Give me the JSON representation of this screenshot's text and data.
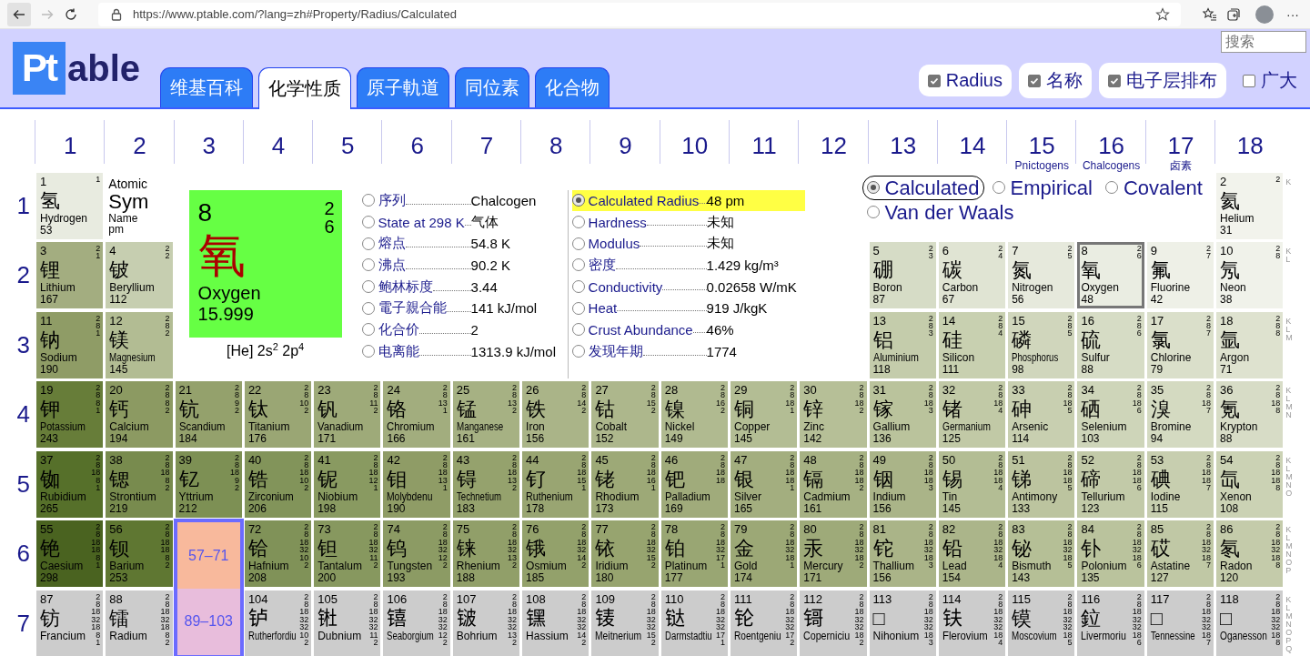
{
  "browser": {
    "url": "https://www.ptable.com/?lang=zh#Property/Radius/Calculated",
    "more": "···"
  },
  "header": {
    "logo": {
      "mark": "Pt",
      "text": "able"
    },
    "tabs": [
      {
        "label": "维基百科",
        "selected": false
      },
      {
        "label": "化学性质",
        "selected": true
      },
      {
        "label": "原子軌道",
        "selected": false
      },
      {
        "label": "同位素",
        "selected": false
      },
      {
        "label": "化合物",
        "selected": false
      }
    ],
    "search": {
      "placeholder": "搜索"
    },
    "options": [
      {
        "label": "Radius",
        "checked": true
      },
      {
        "label": "名称",
        "checked": true
      },
      {
        "label": "电子层排布",
        "checked": true
      },
      {
        "label": "广大",
        "checked": false
      }
    ]
  },
  "groups": [
    {
      "number": "1"
    },
    {
      "number": "2"
    },
    {
      "number": "3"
    },
    {
      "number": "4"
    },
    {
      "number": "5"
    },
    {
      "number": "6"
    },
    {
      "number": "7"
    },
    {
      "number": "8"
    },
    {
      "number": "9"
    },
    {
      "number": "10"
    },
    {
      "number": "11"
    },
    {
      "number": "12"
    },
    {
      "number": "13"
    },
    {
      "number": "14"
    },
    {
      "number": "15",
      "name": "Pnictogens"
    },
    {
      "number": "16",
      "name": "Chalcogens"
    },
    {
      "number": "17",
      "name": "卤素"
    },
    {
      "number": "18"
    }
  ],
  "detail": {
    "number": "8",
    "shells": [
      "2",
      "6"
    ],
    "symbol": "氧",
    "name": "Oxygen",
    "mass": "15.999",
    "configuration": "[He] 2s$^{2}$ 2p$^{4}$",
    "property_columns": [
      {
        "rows": [
          {
            "label": "序列",
            "value": "Chalcogen",
            "selected": false
          },
          {
            "label": "State at 298 K",
            "value": "气体",
            "selected": false
          },
          {
            "label": "熔点",
            "value": "54.8 K",
            "selected": false
          },
          {
            "label": "沸点",
            "value": "90.2 K",
            "selected": false
          },
          {
            "label": "鲍林标度",
            "value": "3.44",
            "selected": false
          },
          {
            "label": "電子親合能",
            "value": "141 kJ/mol",
            "selected": false
          },
          {
            "label": "化合价",
            "value": "2",
            "selected": false
          },
          {
            "label": "电离能",
            "value": "1313.9 kJ/mol",
            "selected": false
          }
        ]
      },
      {
        "rows": [
          {
            "label": "Calculated Radius",
            "value": "48 pm",
            "selected": true
          },
          {
            "label": "Hardness",
            "value": "未知",
            "selected": false
          },
          {
            "label": "Modulus",
            "value": "未知",
            "selected": false
          },
          {
            "label": "密度",
            "value": "1.429 kg/m³",
            "selected": false
          },
          {
            "label": "Conductivity",
            "value": "0.02658 W/mK",
            "selected": false
          },
          {
            "label": "Heat",
            "value": "919 J/kgK",
            "selected": false
          },
          {
            "label": "Crust Abundance",
            "value": "46%",
            "selected": false
          },
          {
            "label": "发现年期",
            "value": "1774",
            "selected": false
          }
        ]
      }
    ]
  },
  "radius_types": [
    {
      "label": "Calculated",
      "selected": true
    },
    {
      "label": "Empirical",
      "selected": false
    },
    {
      "label": "Covalent",
      "selected": false
    },
    {
      "label": "Van der Waals",
      "selected": false
    }
  ],
  "periods": [
    {
      "number": "1",
      "shell_letters": [
        "K"
      ],
      "cells": [
        {
          "kind": "element",
          "number": "1",
          "symbol": "氢",
          "name": "Hydrogen",
          "value": "53",
          "shells": [
            "1"
          ],
          "color": "#e8ebe0",
          "selected": false
        },
        {
          "kind": "legend",
          "number": "Atomic",
          "symbol": "Sym",
          "name": "Name",
          "value": "pm"
        },
        {
          "kind": "element",
          "number": "2",
          "symbol": "氦",
          "name": "Helium",
          "value": "31",
          "shells": [
            "2"
          ],
          "color": "#f2f3ec",
          "selected": false
        }
      ]
    },
    {
      "number": "2",
      "shell_letters": [
        "K",
        "L"
      ],
      "cells": [
        {
          "kind": "element",
          "number": "3",
          "symbol": "锂",
          "name": "Lithium",
          "value": "167",
          "shells": [
            "2",
            "1"
          ],
          "color": "#a3ad80",
          "selected": false
        },
        {
          "kind": "element",
          "number": "4",
          "symbol": "铍",
          "name": "Beryllium",
          "value": "112",
          "shells": [
            "2",
            "2"
          ],
          "color": "#c6ceb0",
          "selected": false
        },
        {
          "kind": "element",
          "number": "5",
          "symbol": "硼",
          "name": "Boron",
          "value": "87",
          "shells": [
            "2",
            "3"
          ],
          "color": "#d6dcc6",
          "selected": false
        },
        {
          "kind": "element",
          "number": "6",
          "symbol": "碳",
          "name": "Carbon",
          "value": "67",
          "shells": [
            "2",
            "4"
          ],
          "color": "#e0e4d3",
          "selected": false
        },
        {
          "kind": "element",
          "number": "7",
          "symbol": "氮",
          "name": "Nitrogen",
          "value": "56",
          "shells": [
            "2",
            "5"
          ],
          "color": "#e6e9dc",
          "selected": false
        },
        {
          "kind": "element",
          "number": "8",
          "symbol": "氧",
          "name": "Oxygen",
          "value": "48",
          "shells": [
            "2",
            "6"
          ],
          "color": "#eaede2",
          "selected": true
        },
        {
          "kind": "element",
          "number": "9",
          "symbol": "氟",
          "name": "Fluorine",
          "value": "42",
          "shells": [
            "2",
            "7"
          ],
          "color": "#eef0e7",
          "selected": false
        },
        {
          "kind": "element",
          "number": "10",
          "symbol": "氖",
          "name": "Neon",
          "value": "38",
          "shells": [
            "2",
            "8"
          ],
          "color": "#f0f2ea",
          "selected": false
        }
      ]
    },
    {
      "number": "3",
      "shell_letters": [
        "K",
        "L",
        "M"
      ],
      "cells": [
        {
          "kind": "element",
          "number": "11",
          "symbol": "钠",
          "name": "Sodium",
          "value": "190",
          "shells": [
            "2",
            "8",
            "1"
          ],
          "color": "#8f9c66",
          "selected": false
        },
        {
          "kind": "element",
          "number": "12",
          "symbol": "镁",
          "name": "Magnesium",
          "value": "145",
          "shells": [
            "2",
            "8",
            "2"
          ],
          "color": "#b2bc93",
          "selected": false
        },
        {
          "kind": "element",
          "number": "13",
          "symbol": "铝",
          "name": "Aluminium",
          "value": "118",
          "shells": [
            "2",
            "8",
            "3"
          ],
          "color": "#c4ccab",
          "selected": false
        },
        {
          "kind": "element",
          "number": "14",
          "symbol": "硅",
          "name": "Silicon",
          "value": "111",
          "shells": [
            "2",
            "8",
            "4"
          ],
          "color": "#c8d0b0",
          "selected": false
        },
        {
          "kind": "element",
          "number": "15",
          "symbol": "磷",
          "name": "Phosphorus",
          "value": "98",
          "shells": [
            "2",
            "8",
            "5"
          ],
          "color": "#d0d6bc",
          "selected": false
        },
        {
          "kind": "element",
          "number": "16",
          "symbol": "硫",
          "name": "Sulfur",
          "value": "88",
          "shells": [
            "2",
            "8",
            "6"
          ],
          "color": "#d6dcc5",
          "selected": false
        },
        {
          "kind": "element",
          "number": "17",
          "symbol": "氯",
          "name": "Chlorine",
          "value": "79",
          "shells": [
            "2",
            "8",
            "7"
          ],
          "color": "#dadfca",
          "selected": false
        },
        {
          "kind": "element",
          "number": "18",
          "symbol": "氩",
          "name": "Argon",
          "value": "71",
          "shells": [
            "2",
            "8",
            "8"
          ],
          "color": "#dee2cf",
          "selected": false
        }
      ]
    },
    {
      "number": "4",
      "shell_letters": [
        "K",
        "L",
        "M",
        "N"
      ],
      "cells": [
        {
          "kind": "element",
          "number": "19",
          "symbol": "钾",
          "name": "Potassium",
          "value": "243",
          "shells": [
            "2",
            "8",
            "8",
            "1"
          ],
          "color": "#677d39",
          "selected": false
        },
        {
          "kind": "element",
          "number": "20",
          "symbol": "钙",
          "name": "Calcium",
          "value": "194",
          "shells": [
            "2",
            "8",
            "8",
            "2"
          ],
          "color": "#8c9a62",
          "selected": false
        },
        {
          "kind": "element",
          "number": "21",
          "symbol": "钪",
          "name": "Scandium",
          "value": "184",
          "shells": [
            "2",
            "8",
            "9",
            "2"
          ],
          "color": "#94a16c",
          "selected": false
        },
        {
          "kind": "element",
          "number": "22",
          "symbol": "钛",
          "name": "Titanium",
          "value": "176",
          "shells": [
            "2",
            "8",
            "10",
            "2"
          ],
          "color": "#9aa674",
          "selected": false
        },
        {
          "kind": "element",
          "number": "23",
          "symbol": "钒",
          "name": "Vanadium",
          "value": "171",
          "shells": [
            "2",
            "8",
            "11",
            "2"
          ],
          "color": "#9eaa79",
          "selected": false
        },
        {
          "kind": "element",
          "number": "24",
          "symbol": "铬",
          "name": "Chromium",
          "value": "166",
          "shells": [
            "2",
            "8",
            "13",
            "1"
          ],
          "color": "#a2ad7e",
          "selected": false
        },
        {
          "kind": "element",
          "number": "25",
          "symbol": "锰",
          "name": "Manganese",
          "value": "161",
          "shells": [
            "2",
            "8",
            "13",
            "2"
          ],
          "color": "#a6b183",
          "selected": false
        },
        {
          "kind": "element",
          "number": "26",
          "symbol": "铁",
          "name": "Iron",
          "value": "156",
          "shells": [
            "2",
            "8",
            "14",
            "2"
          ],
          "color": "#aab488",
          "selected": false
        },
        {
          "kind": "element",
          "number": "27",
          "symbol": "钴",
          "name": "Cobalt",
          "value": "152",
          "shells": [
            "2",
            "8",
            "15",
            "2"
          ],
          "color": "#adb78c",
          "selected": false
        },
        {
          "kind": "element",
          "number": "28",
          "symbol": "镍",
          "name": "Nickel",
          "value": "149",
          "shells": [
            "2",
            "8",
            "16",
            "2"
          ],
          "color": "#b0ba90",
          "selected": false
        },
        {
          "kind": "element",
          "number": "29",
          "symbol": "铜",
          "name": "Copper",
          "value": "145",
          "shells": [
            "2",
            "8",
            "18",
            "1"
          ],
          "color": "#b3bd94",
          "selected": false
        },
        {
          "kind": "element",
          "number": "30",
          "symbol": "锌",
          "name": "Zinc",
          "value": "142",
          "shells": [
            "2",
            "8",
            "18",
            "2"
          ],
          "color": "#b6bf97",
          "selected": false
        },
        {
          "kind": "element",
          "number": "31",
          "symbol": "镓",
          "name": "Gallium",
          "value": "136",
          "shells": [
            "2",
            "8",
            "18",
            "3"
          ],
          "color": "#bac39c",
          "selected": false
        },
        {
          "kind": "element",
          "number": "32",
          "symbol": "锗",
          "name": "Germanium",
          "value": "125",
          "shells": [
            "2",
            "8",
            "18",
            "4"
          ],
          "color": "#c1c9a6",
          "selected": false
        },
        {
          "kind": "element",
          "number": "33",
          "symbol": "砷",
          "name": "Arsenic",
          "value": "114",
          "shells": [
            "2",
            "8",
            "18",
            "5"
          ],
          "color": "#c8cfb0",
          "selected": false
        },
        {
          "kind": "element",
          "number": "34",
          "symbol": "硒",
          "name": "Selenium",
          "value": "103",
          "shells": [
            "2",
            "8",
            "18",
            "6"
          ],
          "color": "#ced5b9",
          "selected": false
        },
        {
          "kind": "element",
          "number": "35",
          "symbol": "溴",
          "name": "Bromine",
          "value": "94",
          "shells": [
            "2",
            "8",
            "18",
            "7"
          ],
          "color": "#d4dac1",
          "selected": false
        },
        {
          "kind": "element",
          "number": "36",
          "symbol": "氪",
          "name": "Krypton",
          "value": "88",
          "shells": [
            "2",
            "8",
            "18",
            "8"
          ],
          "color": "#d7dcc6",
          "selected": false
        }
      ]
    },
    {
      "number": "5",
      "shell_letters": [
        "K",
        "L",
        "M",
        "N",
        "O"
      ],
      "cells": [
        {
          "kind": "element",
          "number": "37",
          "symbol": "铷",
          "name": "Rubidium",
          "value": "265",
          "shells": [
            "2",
            "8",
            "18",
            "8",
            "1"
          ],
          "color": "#56702a",
          "selected": false
        },
        {
          "kind": "element",
          "number": "38",
          "symbol": "锶",
          "name": "Strontium",
          "value": "219",
          "shells": [
            "2",
            "8",
            "18",
            "8",
            "2"
          ],
          "color": "#788b4e",
          "selected": false
        },
        {
          "kind": "element",
          "number": "39",
          "symbol": "钇",
          "name": "Yttrium",
          "value": "212",
          "shells": [
            "2",
            "8",
            "18",
            "9",
            "2"
          ],
          "color": "#7d9054",
          "selected": false
        },
        {
          "kind": "element",
          "number": "40",
          "symbol": "锆",
          "name": "Zirconium",
          "value": "206",
          "shells": [
            "2",
            "8",
            "18",
            "10",
            "2"
          ],
          "color": "#82945a",
          "selected": false
        },
        {
          "kind": "element",
          "number": "41",
          "symbol": "铌",
          "name": "Niobium",
          "value": "198",
          "shells": [
            "2",
            "8",
            "18",
            "12",
            "1"
          ],
          "color": "#899a61",
          "selected": false
        },
        {
          "kind": "element",
          "number": "42",
          "symbol": "钼",
          "name": "Molybdenu",
          "value": "190",
          "shells": [
            "2",
            "8",
            "18",
            "13",
            "1"
          ],
          "color": "#8f9c66",
          "selected": false
        },
        {
          "kind": "element",
          "number": "43",
          "symbol": "锝",
          "name": "Technetium",
          "value": "183",
          "shells": [
            "2",
            "8",
            "18",
            "13",
            "2"
          ],
          "color": "#95a26d",
          "selected": false
        },
        {
          "kind": "element",
          "number": "44",
          "symbol": "钌",
          "name": "Ruthenium",
          "value": "178",
          "shells": [
            "2",
            "8",
            "18",
            "15",
            "1"
          ],
          "color": "#99a572",
          "selected": false
        },
        {
          "kind": "element",
          "number": "45",
          "symbol": "铑",
          "name": "Rhodium",
          "value": "173",
          "shells": [
            "2",
            "8",
            "18",
            "16",
            "1"
          ],
          "color": "#9da977",
          "selected": false
        },
        {
          "kind": "element",
          "number": "46",
          "symbol": "钯",
          "name": "Palladium",
          "value": "169",
          "shells": [
            "2",
            "8",
            "18",
            "18"
          ],
          "color": "#a0ab7b",
          "selected": false
        },
        {
          "kind": "element",
          "number": "47",
          "symbol": "银",
          "name": "Silver",
          "value": "165",
          "shells": [
            "2",
            "8",
            "18",
            "18",
            "1"
          ],
          "color": "#a3ae7f",
          "selected": false
        },
        {
          "kind": "element",
          "number": "48",
          "symbol": "镉",
          "name": "Cadmium",
          "value": "161",
          "shells": [
            "2",
            "8",
            "18",
            "18",
            "2"
          ],
          "color": "#a6b183",
          "selected": false
        },
        {
          "kind": "element",
          "number": "49",
          "symbol": "铟",
          "name": "Indium",
          "value": "156",
          "shells": [
            "2",
            "8",
            "18",
            "18",
            "3"
          ],
          "color": "#aab488",
          "selected": false
        },
        {
          "kind": "element",
          "number": "50",
          "symbol": "锡",
          "name": "Tin",
          "value": "145",
          "shells": [
            "2",
            "8",
            "18",
            "18",
            "4"
          ],
          "color": "#b3bd94",
          "selected": false
        },
        {
          "kind": "element",
          "number": "51",
          "symbol": "锑",
          "name": "Antimony",
          "value": "133",
          "shells": [
            "2",
            "8",
            "18",
            "18",
            "5"
          ],
          "color": "#bcc49f",
          "selected": false
        },
        {
          "kind": "element",
          "number": "52",
          "symbol": "碲",
          "name": "Tellurium",
          "value": "123",
          "shells": [
            "2",
            "8",
            "18",
            "18",
            "6"
          ],
          "color": "#c2caa8",
          "selected": false
        },
        {
          "kind": "element",
          "number": "53",
          "symbol": "碘",
          "name": "Iodine",
          "value": "115",
          "shells": [
            "2",
            "8",
            "18",
            "18",
            "7"
          ],
          "color": "#c7ceaf",
          "selected": false
        },
        {
          "kind": "element",
          "number": "54",
          "symbol": "氙",
          "name": "Xenon",
          "value": "108",
          "shells": [
            "2",
            "8",
            "18",
            "18",
            "8"
          ],
          "color": "#cbd2b4",
          "selected": false
        }
      ]
    },
    {
      "number": "6",
      "shell_letters": [
        "K",
        "L",
        "M",
        "N",
        "O",
        "P"
      ],
      "cells": [
        {
          "kind": "element",
          "number": "55",
          "symbol": "铯",
          "name": "Caesium",
          "value": "298",
          "shells": [
            "2",
            "8",
            "18",
            "18",
            "8",
            "1"
          ],
          "color": "#4a6320",
          "selected": false
        },
        {
          "kind": "element",
          "number": "56",
          "symbol": "钡",
          "name": "Barium",
          "value": "253",
          "shells": [
            "2",
            "8",
            "18",
            "18",
            "8",
            "2"
          ],
          "color": "#5f7732",
          "selected": false
        },
        {
          "kind": "series",
          "label": "57–71",
          "color": "#f8b99c"
        },
        {
          "kind": "element",
          "number": "72",
          "symbol": "铪",
          "name": "Hafnium",
          "value": "208",
          "shells": [
            "2",
            "8",
            "18",
            "32",
            "10",
            "2"
          ],
          "color": "#809258",
          "selected": false
        },
        {
          "kind": "element",
          "number": "73",
          "symbol": "钽",
          "name": "Tantalum",
          "value": "200",
          "shells": [
            "2",
            "8",
            "18",
            "32",
            "11",
            "2"
          ],
          "color": "#87985f",
          "selected": false
        },
        {
          "kind": "element",
          "number": "74",
          "symbol": "钨",
          "name": "Tungsten",
          "value": "193",
          "shells": [
            "2",
            "8",
            "18",
            "32",
            "12",
            "2"
          ],
          "color": "#8c9b64",
          "selected": false
        },
        {
          "kind": "element",
          "number": "75",
          "symbol": "铼",
          "name": "Rhenium",
          "value": "188",
          "shells": [
            "2",
            "8",
            "18",
            "32",
            "13",
            "2"
          ],
          "color": "#919f69",
          "selected": false
        },
        {
          "kind": "element",
          "number": "76",
          "symbol": "锇",
          "name": "Osmium",
          "value": "185",
          "shells": [
            "2",
            "8",
            "18",
            "32",
            "14",
            "2"
          ],
          "color": "#93a16b",
          "selected": false
        },
        {
          "kind": "element",
          "number": "77",
          "symbol": "铱",
          "name": "Iridium",
          "value": "180",
          "shells": [
            "2",
            "8",
            "18",
            "32",
            "15",
            "2"
          ],
          "color": "#97a46f",
          "selected": false
        },
        {
          "kind": "element",
          "number": "78",
          "symbol": "铂",
          "name": "Platinum",
          "value": "177",
          "shells": [
            "2",
            "8",
            "18",
            "32",
            "17",
            "1"
          ],
          "color": "#99a673",
          "selected": false
        },
        {
          "kind": "element",
          "number": "79",
          "symbol": "金",
          "name": "Gold",
          "value": "174",
          "shells": [
            "2",
            "8",
            "18",
            "32",
            "18",
            "1"
          ],
          "color": "#9ca876",
          "selected": false
        },
        {
          "kind": "element",
          "number": "80",
          "symbol": "汞",
          "name": "Mercury",
          "value": "171",
          "shells": [
            "2",
            "8",
            "18",
            "32",
            "18",
            "2"
          ],
          "color": "#9eaa79",
          "selected": false
        },
        {
          "kind": "element",
          "number": "81",
          "symbol": "铊",
          "name": "Thallium",
          "value": "156",
          "shells": [
            "2",
            "8",
            "18",
            "32",
            "18",
            "3"
          ],
          "color": "#aab488",
          "selected": false
        },
        {
          "kind": "element",
          "number": "82",
          "symbol": "铅",
          "name": "Lead",
          "value": "154",
          "shells": [
            "2",
            "8",
            "18",
            "32",
            "18",
            "4"
          ],
          "color": "#abb58a",
          "selected": false
        },
        {
          "kind": "element",
          "number": "83",
          "symbol": "铋",
          "name": "Bismuth",
          "value": "143",
          "shells": [
            "2",
            "8",
            "18",
            "32",
            "18",
            "5"
          ],
          "color": "#b5bf96",
          "selected": false
        },
        {
          "kind": "element",
          "number": "84",
          "symbol": "钋",
          "name": "Polonium",
          "value": "135",
          "shells": [
            "2",
            "8",
            "18",
            "32",
            "18",
            "6"
          ],
          "color": "#bac39d",
          "selected": false
        },
        {
          "kind": "element",
          "number": "85",
          "symbol": "砹",
          "name": "Astatine",
          "value": "127",
          "shells": [
            "2",
            "8",
            "18",
            "32",
            "18",
            "7"
          ],
          "color": "#c0c8a5",
          "selected": false
        },
        {
          "kind": "element",
          "number": "86",
          "symbol": "氡",
          "name": "Radon",
          "value": "120",
          "shells": [
            "2",
            "8",
            "18",
            "32",
            "18",
            "8"
          ],
          "color": "#c4cbaa",
          "selected": false
        }
      ]
    },
    {
      "number": "7",
      "shell_letters": [
        "K",
        "L",
        "M",
        "N",
        "O",
        "P",
        "Q"
      ],
      "cells": [
        {
          "kind": "element",
          "number": "87",
          "symbol": "钫",
          "name": "Francium",
          "shells": [
            "2",
            "8",
            "18",
            "32",
            "18",
            "8",
            "1"
          ],
          "color": "#cccccc",
          "selected": false
        },
        {
          "kind": "element",
          "number": "88",
          "symbol": "镭",
          "name": "Radium",
          "shells": [
            "2",
            "8",
            "18",
            "32",
            "18",
            "8",
            "2"
          ],
          "color": "#cccccc",
          "selected": false
        },
        {
          "kind": "series",
          "label": "89–103",
          "color": "#e8bddc"
        },
        {
          "kind": "element",
          "number": "104",
          "symbol": "𬬻",
          "name": "Rutherfordiu",
          "shells": [
            "2",
            "8",
            "18",
            "32",
            "32",
            "10",
            "2"
          ],
          "color": "#cccccc",
          "selected": false
        },
        {
          "kind": "element",
          "number": "105",
          "symbol": "𬭊",
          "name": "Dubnium",
          "shells": [
            "2",
            "8",
            "18",
            "32",
            "32",
            "11",
            "2"
          ],
          "color": "#cccccc",
          "selected": false
        },
        {
          "kind": "element",
          "number": "106",
          "symbol": "𬭳",
          "name": "Seaborgium",
          "shells": [
            "2",
            "8",
            "18",
            "32",
            "32",
            "12",
            "2"
          ],
          "color": "#cccccc",
          "selected": false
        },
        {
          "kind": "element",
          "number": "107",
          "symbol": "𬭛",
          "name": "Bohrium",
          "shells": [
            "2",
            "8",
            "18",
            "32",
            "32",
            "13",
            "2"
          ],
          "color": "#cccccc",
          "selected": false
        },
        {
          "kind": "element",
          "number": "108",
          "symbol": "𬭶",
          "name": "Hassium",
          "shells": [
            "2",
            "8",
            "18",
            "32",
            "32",
            "14",
            "2"
          ],
          "color": "#cccccc",
          "selected": false
        },
        {
          "kind": "element",
          "number": "109",
          "symbol": "鿏",
          "name": "Meitnerium",
          "shells": [
            "2",
            "8",
            "18",
            "32",
            "32",
            "15",
            "2"
          ],
          "color": "#cccccc",
          "selected": false
        },
        {
          "kind": "element",
          "number": "110",
          "symbol": "𫟼",
          "name": "Darmstadtiu",
          "shells": [
            "2",
            "8",
            "18",
            "32",
            "32",
            "17",
            "1"
          ],
          "color": "#cccccc",
          "selected": false
        },
        {
          "kind": "element",
          "number": "111",
          "symbol": "𬬭",
          "name": "Roentgeniu",
          "shells": [
            "2",
            "8",
            "18",
            "32",
            "32",
            "17",
            "2"
          ],
          "color": "#cccccc",
          "selected": false
        },
        {
          "kind": "element",
          "number": "112",
          "symbol": "鿔",
          "name": "Coperniciu",
          "shells": [
            "2",
            "8",
            "18",
            "32",
            "32",
            "18",
            "2"
          ],
          "color": "#cccccc",
          "selected": false
        },
        {
          "kind": "element",
          "number": "113",
          "symbol": "□",
          "name": "Nihonium",
          "shells": [
            "2",
            "8",
            "18",
            "32",
            "32",
            "18",
            "3"
          ],
          "color": "#cccccc",
          "selected": false
        },
        {
          "kind": "element",
          "number": "114",
          "symbol": "𫓧",
          "name": "Flerovium",
          "shells": [
            "2",
            "8",
            "18",
            "32",
            "32",
            "18",
            "4"
          ],
          "color": "#cccccc",
          "selected": false
        },
        {
          "kind": "element",
          "number": "115",
          "symbol": "镆",
          "name": "Moscovium",
          "shells": [
            "2",
            "8",
            "18",
            "32",
            "32",
            "18",
            "5"
          ],
          "color": "#cccccc",
          "selected": false
        },
        {
          "kind": "element",
          "number": "116",
          "symbol": "鉝",
          "name": "Livermoriu",
          "shells": [
            "2",
            "8",
            "18",
            "32",
            "32",
            "18",
            "6"
          ],
          "color": "#cccccc",
          "selected": false
        },
        {
          "kind": "element",
          "number": "117",
          "symbol": "□",
          "name": "Tennessine",
          "shells": [
            "2",
            "8",
            "18",
            "32",
            "32",
            "18",
            "7"
          ],
          "color": "#cccccc",
          "selected": false
        },
        {
          "kind": "element",
          "number": "118",
          "symbol": "□",
          "name": "Oganesson",
          "shells": [
            "2",
            "8",
            "18",
            "32",
            "32",
            "18",
            "8"
          ],
          "color": "#cccccc",
          "selected": false
        }
      ]
    }
  ]
}
